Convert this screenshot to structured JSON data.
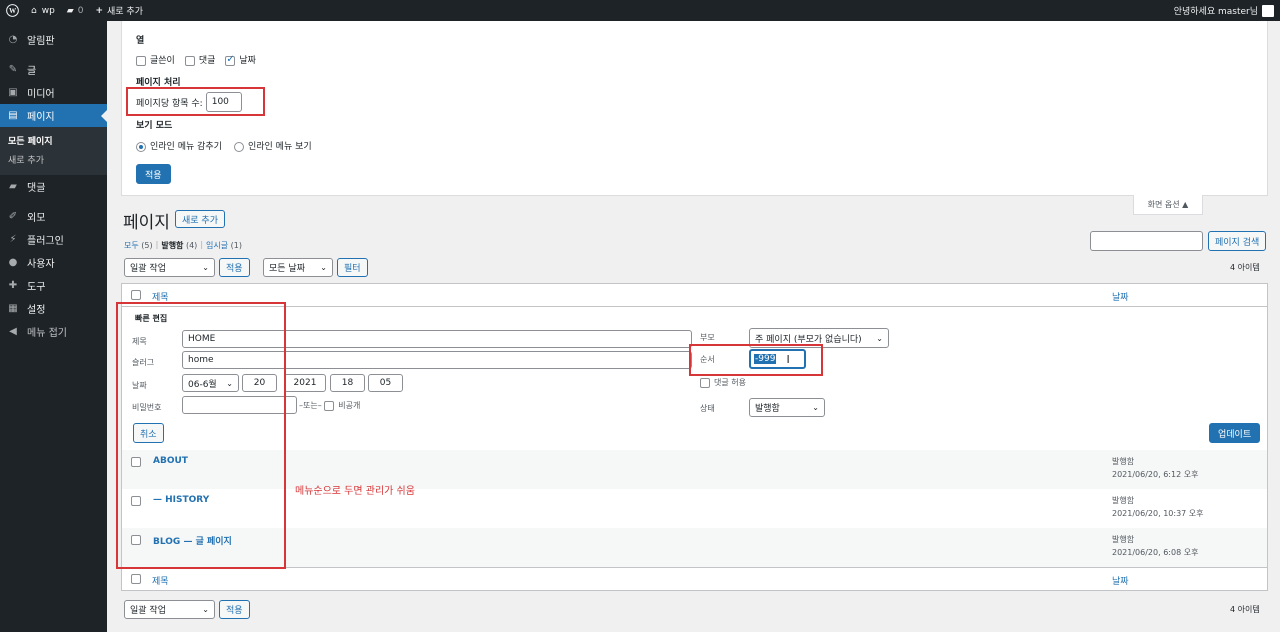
{
  "adminbar": {
    "site": "wp",
    "comments": "0",
    "new": "새로 추가",
    "greeting": "안녕하세요 master님"
  },
  "sidebar": {
    "items": [
      {
        "label": "알림판",
        "icon": "dashboard-icon"
      },
      {
        "label": "글",
        "icon": "pin-icon"
      },
      {
        "label": "미디어",
        "icon": "media-icon"
      },
      {
        "label": "페이지",
        "icon": "page-icon"
      },
      {
        "label": "댓글",
        "icon": "comment-icon"
      },
      {
        "label": "외모",
        "icon": "brush-icon"
      },
      {
        "label": "플러그인",
        "icon": "plugin-icon"
      },
      {
        "label": "사용자",
        "icon": "user-icon"
      },
      {
        "label": "도구",
        "icon": "wrench-icon"
      },
      {
        "label": "설정",
        "icon": "settings-icon"
      },
      {
        "label": "메뉴 접기",
        "icon": "collapse-icon"
      }
    ],
    "submenu": [
      "모든 페이지",
      "새로 추가"
    ]
  },
  "screen_options": {
    "columns_legend": "열",
    "columns": [
      {
        "label": "글쓴이",
        "checked": false
      },
      {
        "label": "댓글",
        "checked": false
      },
      {
        "label": "날짜",
        "checked": true
      }
    ],
    "pagination_legend": "페이지 처리",
    "per_page_label": "페이지당 항목 수:",
    "per_page_value": "100",
    "view_mode_legend": "보기 모드",
    "view_modes": [
      {
        "label": "인라인 메뉴 감추기",
        "checked": true
      },
      {
        "label": "인라인 메뉴 보기",
        "checked": false
      }
    ],
    "apply": "적용",
    "toggle_label": "화면 옵션 ▲"
  },
  "page": {
    "title": "페이지",
    "add_new": "새로 추가",
    "filters": [
      {
        "label": "모두",
        "count": "(5)"
      },
      {
        "label": "발행함",
        "count": "(4)"
      },
      {
        "label": "임시글",
        "count": "(1)"
      }
    ],
    "search_button": "페이지 검색",
    "bulk_action": "일괄 작업",
    "apply": "적용",
    "all_dates": "모든 날짜",
    "filter": "필터",
    "items_count": "4 아이템",
    "col_title": "제목",
    "col_date": "날짜"
  },
  "quick_edit": {
    "heading": "빠른 편집",
    "title_label": "제목",
    "title_value": "HOME",
    "slug_label": "슬러그",
    "slug_value": "home",
    "date_label": "날짜",
    "month": "06-6월",
    "day": "20",
    "year": "2021",
    "hour": "18",
    "minute": "05",
    "password_label": "비밀번호",
    "or_text": "–또는–",
    "private_label": "비공개",
    "parent_label": "부모",
    "parent_value": "주 페이지 (부모가 없습니다)",
    "order_label": "순서",
    "order_value": "-999",
    "allow_comments": "댓글 허용",
    "status_label": "상태",
    "status_value": "발행함",
    "cancel": "취소",
    "update": "업데이트"
  },
  "rows": [
    {
      "title": "ABOUT",
      "status": "발행함",
      "date": "2021/06/20, 6:12 오후"
    },
    {
      "title": "— HISTORY",
      "status": "발행함",
      "date": "2021/06/20, 10:37 오후"
    },
    {
      "title": "BLOG — 글 페이지",
      "status": "발행함",
      "date": "2021/06/20, 6:08 오후"
    }
  ],
  "annotation": "메뉴순으로 두면 관리가 쉬움",
  "colors": {
    "accent": "#2271b1",
    "annotation_red": "#d63638",
    "admin_dark": "#1d2327"
  }
}
